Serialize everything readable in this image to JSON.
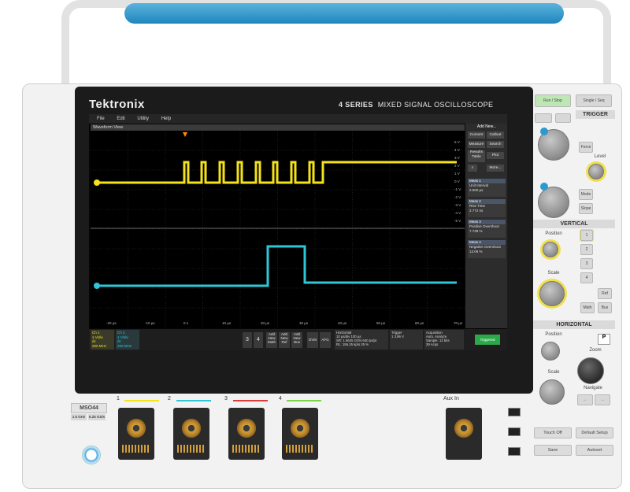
{
  "brand": "Tektronix",
  "model_series": "4 SERIES",
  "model_desc": "MIXED SIGNAL OSCILLOSCOPE",
  "menu": [
    "File",
    "Edit",
    "Utility",
    "Help"
  ],
  "waveform_view_title": "Waveform View",
  "right_panel": {
    "add_new": "Add New...",
    "buttons": [
      "Cursors",
      "Callout",
      "Measure",
      "Search",
      "Results Table",
      "Plot",
      "More..."
    ],
    "measurements": [
      {
        "title": "Meas 1",
        "name": "Unit Interval",
        "value": "2.500 µs",
        "tag": "C1"
      },
      {
        "title": "Meas 2",
        "name": "Rise Time",
        "value": "2.772 ns",
        "tag": "C1"
      },
      {
        "title": "Meas 3",
        "name": "Positive Overshoot",
        "value": "7.739 %",
        "tag": "C2"
      },
      {
        "title": "Meas 4",
        "name": "Negative Overshoot",
        "value": "13.06 %",
        "tag": "C2"
      }
    ]
  },
  "y_ticks": [
    "5 V",
    "4 V",
    "3 V",
    "2 V",
    "1 V",
    "0 V",
    "-1 V",
    "-2 V",
    "-3 V",
    "-4 V",
    "-5 V"
  ],
  "x_ticks": [
    "-20 µs",
    "-10 µs",
    "0 s",
    "10 µs",
    "20 µs",
    "30 µs",
    "40 µs",
    "50 µs",
    "60 µs",
    "70 µs"
  ],
  "channels": [
    {
      "label": "Ch 1",
      "scale": "1 V/div",
      "coupling": "dc",
      "bw": "200 MHz",
      "color": "#f4e21a"
    },
    {
      "label": "Ch 2",
      "scale": "1 V/div",
      "coupling": "dc",
      "bw": "200 MHz",
      "color": "#2ec7d6"
    }
  ],
  "bottom_buttons": [
    "3",
    "4",
    "Add New Math",
    "Add New Ref",
    "Add New Bus",
    "DVM",
    "AFG"
  ],
  "horizontal_info": {
    "title": "Horizontal",
    "l1": "10 µs/div    100 µs",
    "l2": "SR: 1.5625 GS/s 640 ps/pt",
    "l3": "RL: 156.25 kpts  25 %"
  },
  "trigger_info": {
    "title": "Trigger",
    "l1": "1   3.96 V"
  },
  "acquisition_info": {
    "title": "Acquisition",
    "l1": "Auto,       Analyze",
    "l2": "Sample: 12 bits",
    "l3": "29 Acqs"
  },
  "triggered_label": "Triggered",
  "controls": {
    "run_stop": "Run / Stop",
    "single_seq": "Single / Seq",
    "trigger_title": "TRIGGER",
    "level_label": "Level",
    "vertical_title": "VERTICAL",
    "position_label": "Position",
    "scale_label": "Scale",
    "horizontal_title": "HORIZONTAL",
    "zoom_label": "Zoom",
    "navigate_label": "Navigate",
    "force": "Force",
    "mode": "Mode",
    "slope": "Slope",
    "math": "Math",
    "ref": "Ref",
    "bus": "Bus",
    "ch_buttons": [
      "1",
      "2",
      "3",
      "4"
    ],
    "touch_off": "Touch Off",
    "default_setup": "Default Setup",
    "save": "Save",
    "autoset": "Autoset"
  },
  "front": {
    "model_badge": "MSO44",
    "bw_badges": [
      "1.5 GHz",
      "6.25 GS/s"
    ],
    "ch_labels": [
      "1",
      "2",
      "3",
      "4"
    ],
    "aux_in": "Aux In",
    "ch_colors": [
      "#f4e21a",
      "#2ec7d6",
      "#e03b3b",
      "#7bd34a"
    ]
  }
}
